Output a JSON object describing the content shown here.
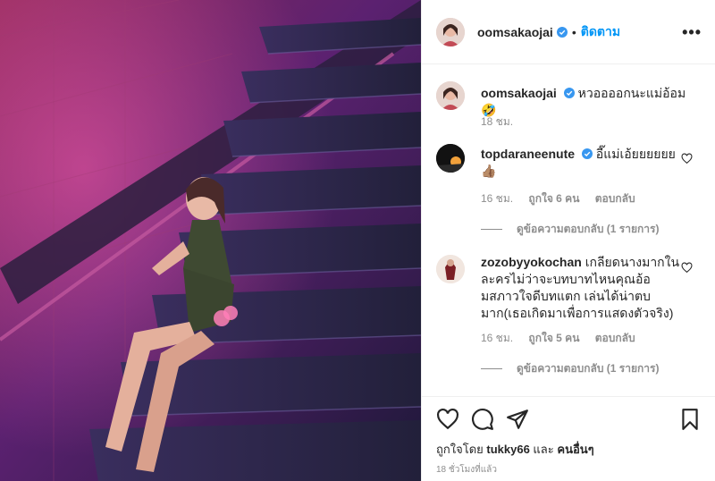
{
  "header": {
    "username": "oomsakaojai",
    "separator": "•",
    "follow_label": "ติดตาม",
    "more_label": "•••"
  },
  "caption": {
    "username": "oomsakaojai",
    "text": "หวออออกนะแม่อ้อม 🤣",
    "time": "18 ชม."
  },
  "comments": [
    {
      "username": "topdaraneenute",
      "text_line1": "อี๊แม่เอ้ยยยยยย",
      "text_line2": "👍🏽",
      "time": "16 ชม.",
      "likes": "ถูกใจ 6 คน",
      "reply_label": "ตอบกลับ",
      "view_replies": "ดูข้อความตอบกลับ (1 รายการ)"
    },
    {
      "username": "zozobyyokochan",
      "text_line1": "เกลียดนางมากใน",
      "text_line2": "ละครไม่ว่าจะบทบาทไหนคุณอ้อ",
      "text_line3": "มสภาวใจดีบทแตก เล่นได้น่าตบ",
      "text_line4": "มาก(เธอเกิดมาเพื่อการแสดงตัวจริง)",
      "time": "16 ชม.",
      "likes": "ถูกใจ 5 คน",
      "reply_label": "ตอบกลับ",
      "view_replies": "ดูข้อความตอบกลับ (1 รายการ)"
    }
  ],
  "footer": {
    "liked_by_prefix": "ถูกใจโดย",
    "liked_by_user": "tukky66",
    "liked_by_and": "และ",
    "liked_by_others": "คนอื่นๆ",
    "timestamp": "18 ชั่วโมงที่แล้ว"
  },
  "colors": {
    "accent": "#0095f6",
    "verified": "#3897f0",
    "muted": "#8e8e8e",
    "text": "#262626"
  },
  "icons": {
    "like": "heart-icon",
    "comment": "comment-icon",
    "share": "share-icon",
    "save": "bookmark-icon",
    "verified": "verified-badge-icon",
    "more": "more-options-icon"
  }
}
